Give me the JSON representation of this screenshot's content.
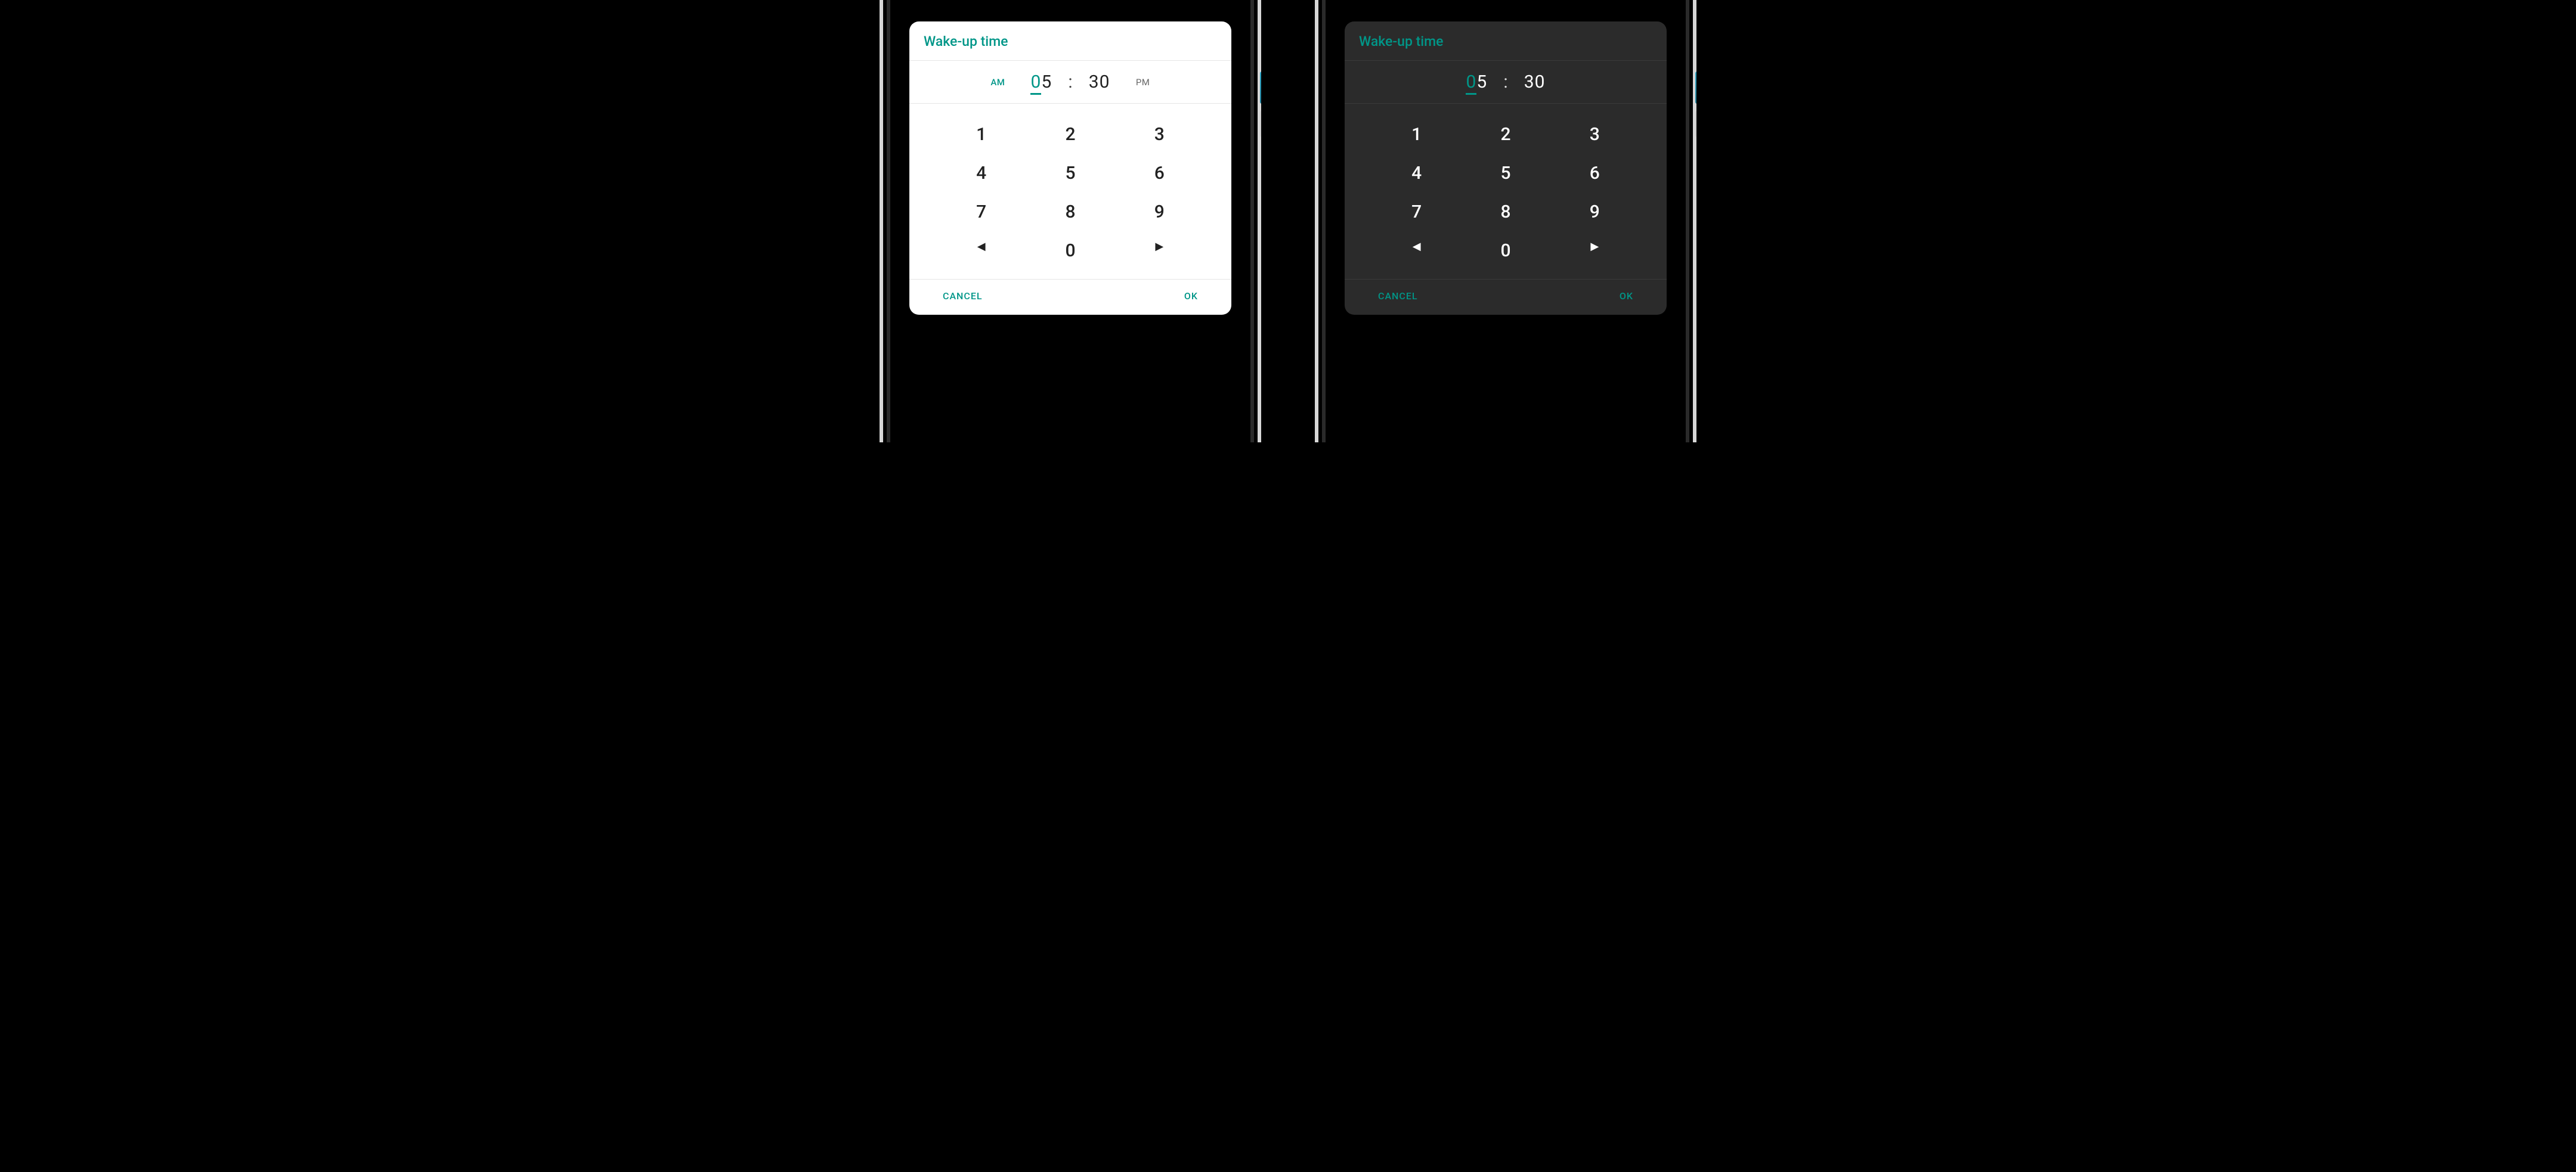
{
  "accent": "#009688",
  "title": "Wake-up time",
  "time": {
    "hour_lead": "0",
    "hour_rest": "5",
    "minute": "30",
    "is24h": false
  },
  "ampm": {
    "am": "AM",
    "pm": "PM",
    "selected": "AM"
  },
  "keypad": {
    "rows": [
      [
        "1",
        "2",
        "3"
      ],
      [
        "4",
        "5",
        "6"
      ],
      [
        "7",
        "8",
        "9"
      ]
    ],
    "zero": "0",
    "left_icon": "chevron-left-icon",
    "right_icon": "chevron-right-icon"
  },
  "actions": {
    "cancel": "CANCEL",
    "ok": "OK"
  },
  "variants": [
    "light",
    "dark"
  ]
}
